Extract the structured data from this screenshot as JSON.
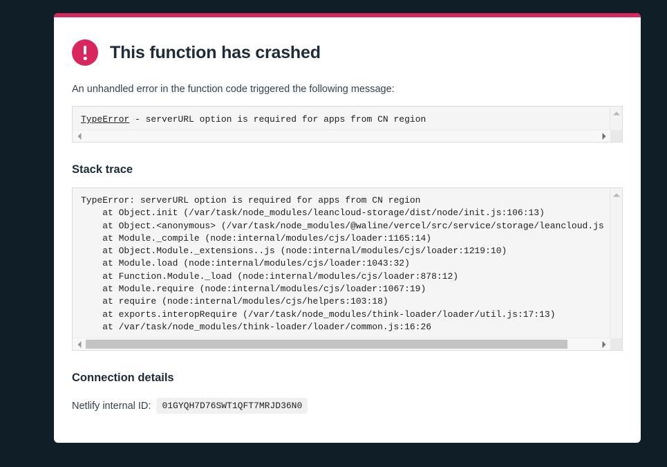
{
  "theme": {
    "page_background": "#101e27",
    "card_background": "#ffffff",
    "accent": "#d9275e",
    "heading_color": "#1f2b36",
    "body_text_color": "#35424d",
    "code_background": "#f5f5f5"
  },
  "card": {
    "accent_bar_color": "#d9275e",
    "alert_icon": "alert-exclamation-circle-icon",
    "title": "This function has crashed",
    "subtitle": "An unhandled error in the function code triggered the following message:"
  },
  "error_message": {
    "error_type": "TypeError",
    "separator": " - ",
    "message": "serverURL option is required for apps from CN region",
    "full_text": "TypeError - serverURL option is required for apps from CN region"
  },
  "stack_trace": {
    "heading": "Stack trace",
    "text": "TypeError: serverURL option is required for apps from CN region\n    at Object.init (/var/task/node_modules/leancloud-storage/dist/node/init.js:106:13)\n    at Object.<anonymous> (/var/task/node_modules/@waline/vercel/src/service/storage/leancloud.js\n    at Module._compile (node:internal/modules/cjs/loader:1165:14)\n    at Object.Module._extensions..js (node:internal/modules/cjs/loader:1219:10)\n    at Module.load (node:internal/modules/cjs/loader:1043:32)\n    at Function.Module._load (node:internal/modules/cjs/loader:878:12)\n    at Module.require (node:internal/modules/cjs/loader:1067:19)\n    at require (node:internal/modules/cjs/helpers:103:18)\n    at exports.interopRequire (/var/task/node_modules/think-loader/loader/util.js:17:13)\n    at /var/task/node_modules/think-loader/loader/common.js:16:26",
    "lines": [
      "TypeError: serverURL option is required for apps from CN region",
      "    at Object.init (/var/task/node_modules/leancloud-storage/dist/node/init.js:106:13)",
      "    at Object.<anonymous> (/var/task/node_modules/@waline/vercel/src/service/storage/leancloud.js",
      "    at Module._compile (node:internal/modules/cjs/loader:1165:14)",
      "    at Object.Module._extensions..js (node:internal/modules/cjs/loader:1219:10)",
      "    at Module.load (node:internal/modules/cjs/loader:1043:32)",
      "    at Function.Module._load (node:internal/modules/cjs/loader:878:12)",
      "    at Module.require (node:internal/modules/cjs/loader:1067:19)",
      "    at require (node:internal/modules/cjs/helpers:103:18)",
      "    at exports.interopRequire (/var/task/node_modules/think-loader/loader/util.js:17:13)",
      "    at /var/task/node_modules/think-loader/loader/common.js:16:26"
    ]
  },
  "connection_details": {
    "heading": "Connection details",
    "id_label": "Netlify internal ID:",
    "id_value": "01GYQH7D76SWT1QFT7MRJD36N0"
  },
  "scrollbars": {
    "up_arrow_icon": "scroll-up-arrow-icon",
    "down_arrow_icon": "scroll-down-arrow-icon",
    "left_arrow_icon": "scroll-left-arrow-icon",
    "right_arrow_icon": "scroll-right-arrow-icon"
  }
}
